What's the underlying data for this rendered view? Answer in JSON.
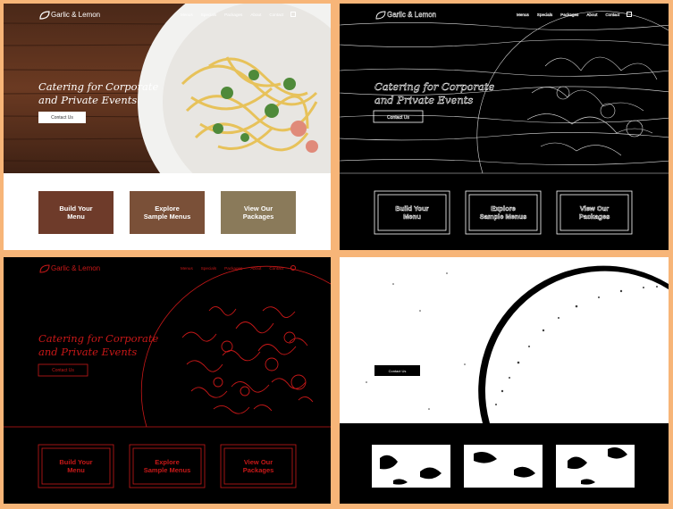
{
  "brand": {
    "name": "Garlic & Lemon"
  },
  "nav": {
    "items": [
      "Menus",
      "Specials",
      "Packages",
      "About",
      "Contact"
    ],
    "icon": "instagram-icon"
  },
  "hero": {
    "title_line1": "Catering for Corporate",
    "title_line2": "and Private Events",
    "cta_label": "Contact Us"
  },
  "cards": [
    {
      "line1": "Build Your",
      "line2": "Menu"
    },
    {
      "line1": "Explore",
      "line2": "Sample Menus"
    },
    {
      "line1": "View Our",
      "line2": "Packages"
    }
  ],
  "colors": {
    "frame": "#f7b578",
    "wood": "#5a3220",
    "edge_red": "#c81818",
    "white": "#ffffff",
    "black": "#000000"
  }
}
